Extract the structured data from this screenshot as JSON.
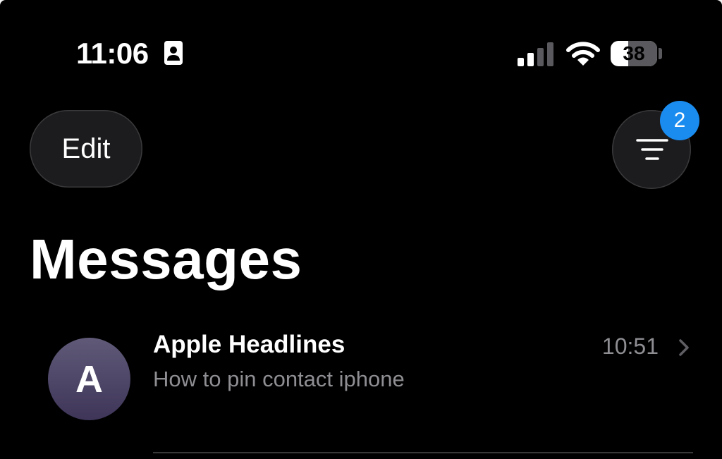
{
  "status_bar": {
    "time": "11:06",
    "focus_icon": "person-id-icon",
    "signal_icon": "cellular-signal-icon",
    "wifi_icon": "wifi-icon",
    "battery_level": "38",
    "battery_fraction": 0.38
  },
  "header": {
    "edit_label": "Edit",
    "filter_icon": "filter-lines-icon",
    "filter_badge": "2",
    "title": "Messages"
  },
  "conversations": [
    {
      "avatar_initial": "A",
      "sender": "Apple Headlines",
      "time": "10:51",
      "preview": "How to pin contact iphone",
      "chevron_icon": "chevron-right-icon"
    }
  ],
  "colors": {
    "background": "#000000",
    "button_fill": "#1c1c1e",
    "badge": "#1a8cf0",
    "secondary_text": "#8e8e93",
    "avatar_top": "#605a78",
    "avatar_bottom": "#3e3558"
  }
}
